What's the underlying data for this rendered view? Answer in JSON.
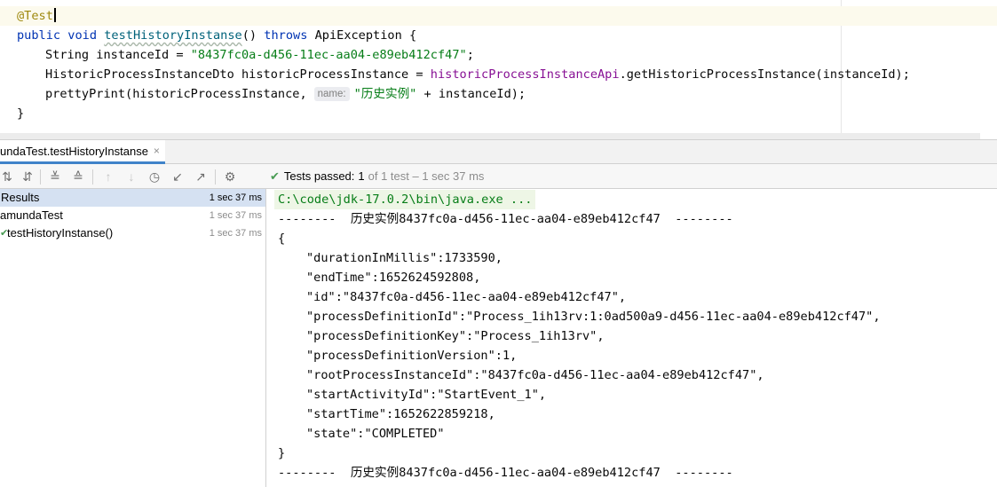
{
  "editor": {
    "annotation": "@Test",
    "method": {
      "modifiers": "public void",
      "name": "testHistoryInstanse",
      "params": "()",
      "throws_kw": "throws",
      "exception": "ApiException {"
    },
    "line2": {
      "type_var": "String instanceId = ",
      "value": "\"8437fc0a-d456-11ec-aa04-e89eb412cf47\"",
      "end": ";"
    },
    "line3": {
      "decl": "HistoricProcessInstanceDto historicProcessInstance = ",
      "field": "historicProcessInstanceApi",
      "call": ".getHistoricProcessInstance(instanceId);"
    },
    "line4": {
      "call": "prettyPrint(historicProcessInstance,",
      "hint": "name:",
      "str": "\"历史实例\"",
      "rest": " + instanceId);"
    },
    "close_brace": "}"
  },
  "run_tab": {
    "label": "undaTest.testHistoryInstanse",
    "close": "×"
  },
  "toolbar": {
    "icons": [
      "sort-alpha-icon",
      "sort-duration-icon",
      "expand-all-icon",
      "collapse-all-icon",
      "prev-failed-icon",
      "next-failed-icon",
      "history-icon",
      "import-icon",
      "export-icon",
      "settings-icon"
    ],
    "status_prefix": "Tests passed:",
    "status_count": "1",
    "status_detail": "of 1 test – 1 sec 37 ms"
  },
  "tree": {
    "rows": [
      {
        "name": "Results",
        "duration": "1 sec 37 ms"
      },
      {
        "name": "amundaTest",
        "duration": "1 sec 37 ms"
      },
      {
        "name": "testHistoryInstanse()",
        "duration": "1 sec 37 ms"
      }
    ]
  },
  "console": {
    "command": "C:\\code\\jdk-17.0.2\\bin\\java.exe ...",
    "separator_top": "--------  历史实例8437fc0a-d456-11ec-aa04-e89eb412cf47  --------",
    "open_brace": "{",
    "fields": [
      "\"durationInMillis\":1733590,",
      "\"endTime\":1652624592808,",
      "\"id\":\"8437fc0a-d456-11ec-aa04-e89eb412cf47\",",
      "\"processDefinitionId\":\"Process_1ih13rv:1:0ad500a9-d456-11ec-aa04-e89eb412cf47\",",
      "\"processDefinitionKey\":\"Process_1ih13rv\",",
      "\"processDefinitionVersion\":1,",
      "\"rootProcessInstanceId\":\"8437fc0a-d456-11ec-aa04-e89eb412cf47\",",
      "\"startActivityId\":\"StartEvent_1\",",
      "\"startTime\":1652622859218,",
      "\"state\":\"COMPLETED\""
    ],
    "close_brace": "}",
    "separator_bottom": "--------  历史实例8437fc0a-d456-11ec-aa04-e89eb412cf47  --------"
  },
  "colors": {
    "keyword": "#0033b3",
    "string": "#067d17",
    "annotation": "#9e880d",
    "field": "#871094",
    "pass": "#499c54",
    "selection": "#d5e1f2"
  }
}
